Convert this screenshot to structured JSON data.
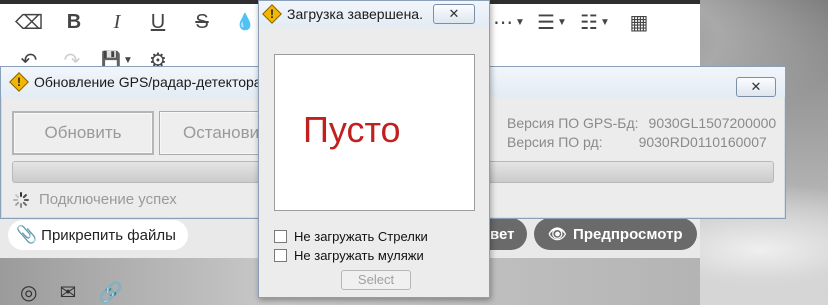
{
  "gps_window": {
    "title": "Обновление GPS/радар-детектора",
    "close_label": "✕",
    "update_button": "Обновить",
    "stop_button": "Остановить",
    "version_gps_label": "Версия ПО GPS-Бд:",
    "version_gps_value": "9030GL1507200000",
    "version_rd_label": "Версия ПО рд:",
    "version_rd_value": "9030RD0110160007",
    "status": "Подключение успех"
  },
  "download_dialog": {
    "title": "Загрузка завершена.",
    "close_label": "✕",
    "empty_text": "Пусто",
    "checkbox_1": "Не загружать Стрелки",
    "checkbox_2": "Не загружать муляжи",
    "select_button": "Select"
  },
  "background_editor": {
    "attach_label": "Прикрепить файлы",
    "answer_label": "вет",
    "preview_label": "Предпросмотр"
  },
  "icons": {
    "eraser": "⌫",
    "bold": "B",
    "italic": "I",
    "underline": "U",
    "strike": "S",
    "drop": "💧",
    "more": "⋯",
    "align": "☰",
    "list": "☷",
    "table": "▦",
    "undo": "↶",
    "redo": "↷",
    "save": "💾",
    "settings": "⚙",
    "paperclip": "📎",
    "eye": "👁",
    "whatsapp": "◎",
    "mail": "✉",
    "link": "🔗"
  },
  "colors": {
    "empty_text": "#c21f1f",
    "window_border": "#8aa0b8"
  }
}
